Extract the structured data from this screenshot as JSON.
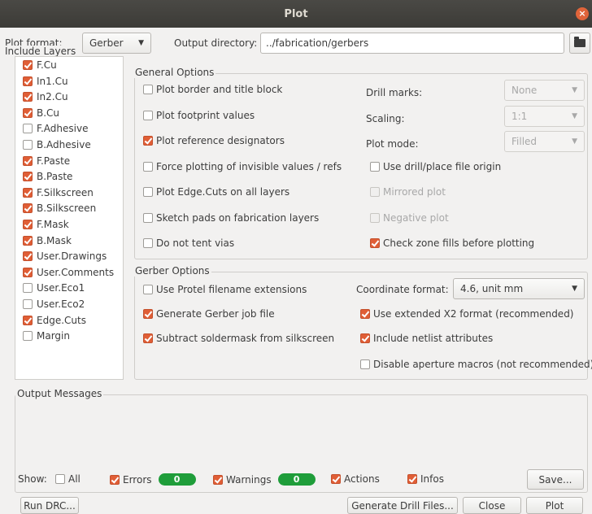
{
  "window": {
    "title": "Plot",
    "close_glyph": "×"
  },
  "header": {
    "plot_format_label": "Plot format:",
    "plot_format_value": "Gerber",
    "output_dir_label": "Output directory:",
    "output_dir_value": "../fabrication/gerbers"
  },
  "layers": {
    "title": "Include Layers",
    "items": [
      {
        "label": "F.Cu",
        "checked": true
      },
      {
        "label": "In1.Cu",
        "checked": true
      },
      {
        "label": "In2.Cu",
        "checked": true
      },
      {
        "label": "B.Cu",
        "checked": true
      },
      {
        "label": "F.Adhesive",
        "checked": false
      },
      {
        "label": "B.Adhesive",
        "checked": false
      },
      {
        "label": "F.Paste",
        "checked": true
      },
      {
        "label": "B.Paste",
        "checked": true
      },
      {
        "label": "F.Silkscreen",
        "checked": true
      },
      {
        "label": "B.Silkscreen",
        "checked": true
      },
      {
        "label": "F.Mask",
        "checked": true
      },
      {
        "label": "B.Mask",
        "checked": true
      },
      {
        "label": "User.Drawings",
        "checked": true
      },
      {
        "label": "User.Comments",
        "checked": true
      },
      {
        "label": "User.Eco1",
        "checked": false
      },
      {
        "label": "User.Eco2",
        "checked": false
      },
      {
        "label": "Edge.Cuts",
        "checked": true
      },
      {
        "label": "Margin",
        "checked": false
      }
    ]
  },
  "general": {
    "title": "General Options",
    "plot_border": {
      "label": "Plot border and title block",
      "checked": false
    },
    "plot_footprint_values": {
      "label": "Plot footprint values",
      "checked": false
    },
    "plot_ref_designators": {
      "label": "Plot reference designators",
      "checked": true
    },
    "force_invisible": {
      "label": "Force plotting of invisible values / refs",
      "checked": false
    },
    "edge_cuts_all": {
      "label": "Plot Edge.Cuts on all layers",
      "checked": false
    },
    "sketch_pads": {
      "label": "Sketch pads on fabrication layers",
      "checked": false
    },
    "no_tent_vias": {
      "label": "Do not tent vias",
      "checked": false
    },
    "drill_marks_label": "Drill marks:",
    "drill_marks_value": "None",
    "scaling_label": "Scaling:",
    "scaling_value": "1:1",
    "plot_mode_label": "Plot mode:",
    "plot_mode_value": "Filled",
    "use_drill_origin": {
      "label": "Use drill/place file origin",
      "checked": false
    },
    "mirrored": {
      "label": "Mirrored plot",
      "checked": false,
      "disabled": true
    },
    "negative": {
      "label": "Negative plot",
      "checked": false,
      "disabled": true
    },
    "check_zone_fills": {
      "label": "Check zone fills before plotting",
      "checked": true
    }
  },
  "gerber": {
    "title": "Gerber Options",
    "protel_ext": {
      "label": "Use Protel filename extensions",
      "checked": false
    },
    "job_file": {
      "label": "Generate Gerber job file",
      "checked": true
    },
    "subtract_soldermask": {
      "label": "Subtract soldermask from silkscreen",
      "checked": true
    },
    "coord_format_label": "Coordinate format:",
    "coord_format_value": "4.6, unit mm",
    "x2_format": {
      "label": "Use extended X2 format (recommended)",
      "checked": true
    },
    "netlist_attrs": {
      "label": "Include netlist attributes",
      "checked": true
    },
    "disable_aperture": {
      "label": "Disable aperture macros (not recommended)",
      "checked": false
    }
  },
  "messages": {
    "title": "Output Messages",
    "show_label": "Show:",
    "all": {
      "label": "All",
      "checked": false
    },
    "errors": {
      "label": "Errors",
      "checked": true,
      "count": "0"
    },
    "warnings": {
      "label": "Warnings",
      "checked": true,
      "count": "0"
    },
    "actions": {
      "label": "Actions",
      "checked": true
    },
    "infos": {
      "label": "Infos",
      "checked": true
    },
    "save_label": "Save..."
  },
  "buttons": {
    "run_drc": "Run DRC...",
    "gen_drill": "Generate Drill Files...",
    "close": "Close",
    "plot": "Plot"
  },
  "colors": {
    "accent": "#e05e36",
    "badge": "#1f9d3a",
    "titlebar": "#3c3b37"
  }
}
